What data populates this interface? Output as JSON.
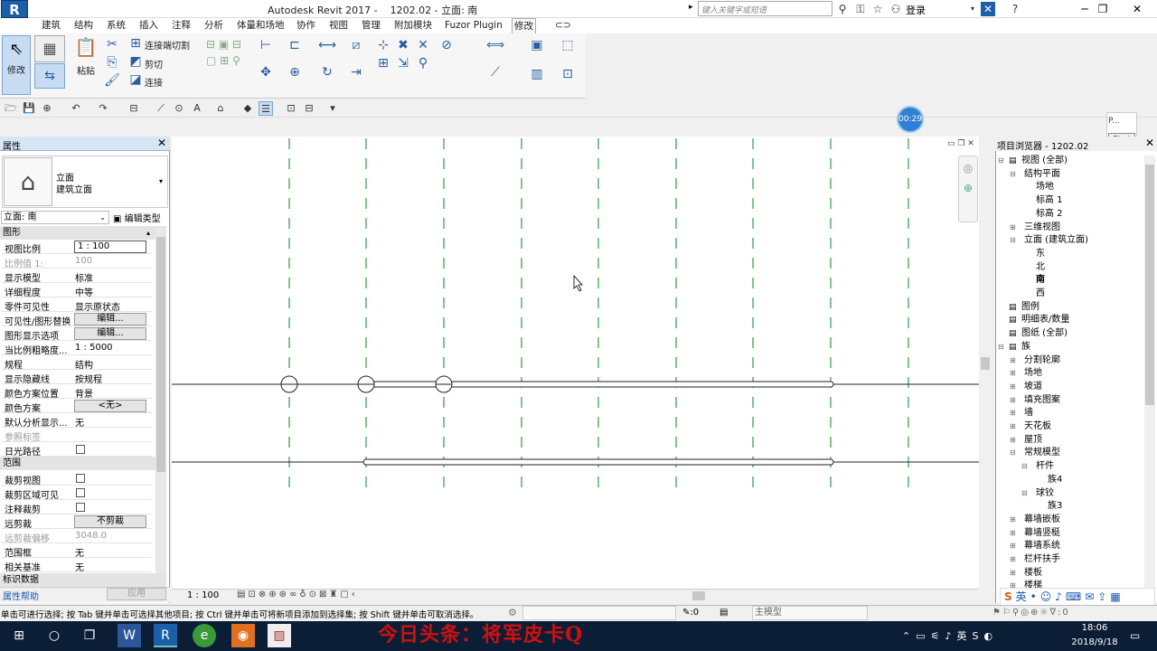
{
  "titlebar": {
    "app_logo": "R",
    "title": "Autodesk Revit 2017 -    1202.02 - 立面: 南",
    "search_placeholder": "键入关键字或短语",
    "login": "登录"
  },
  "tabs": [
    "建筑",
    "结构",
    "系统",
    "插入",
    "注释",
    "分析",
    "体量和场地",
    "协作",
    "视图",
    "管理",
    "附加模块",
    "Fuzor Plugin",
    "修改"
  ],
  "active_tab": "修改",
  "ribbon": {
    "modify_label": "修改",
    "paste_label": "粘贴",
    "join_cut_label": "连接端切割",
    "cut_label": "剪切",
    "join_label": "连接"
  },
  "timer": "00:29",
  "recorder": {
    "label": "P...",
    "start": "Start"
  },
  "properties": {
    "header": "属性",
    "type_line1": "立面",
    "type_line2": "建筑立面",
    "instance_selector": "立面: 南",
    "edit_type": "编辑类型",
    "group_graphics": "图形",
    "rows": [
      {
        "name": "视图比例",
        "value": "1 : 100"
      },
      {
        "name": "比例值 1:",
        "value": "100"
      },
      {
        "name": "显示模型",
        "value": "标准"
      },
      {
        "name": "详细程度",
        "value": "中等"
      },
      {
        "name": "零件可见性",
        "value": "显示原状态"
      },
      {
        "name": "可见性/图形替换",
        "value": "编辑..."
      },
      {
        "name": "图形显示选项",
        "value": "编辑..."
      },
      {
        "name": "当比例粗略度...",
        "value": "1 : 5000"
      },
      {
        "name": "规程",
        "value": "结构"
      },
      {
        "name": "显示隐藏线",
        "value": "按规程"
      },
      {
        "name": "颜色方案位置",
        "value": "背景"
      },
      {
        "name": "颜色方案",
        "value": "<无>"
      },
      {
        "name": "默认分析显示...",
        "value": "无"
      },
      {
        "name": "参照标签",
        "value": ""
      },
      {
        "name": "日光路径",
        "value": ""
      }
    ],
    "group_extents": "范围",
    "rows2": [
      {
        "name": "裁剪视图",
        "value": ""
      },
      {
        "name": "裁剪区域可见",
        "value": ""
      },
      {
        "name": "注释裁剪",
        "value": ""
      },
      {
        "name": "远剪裁",
        "value": "不剪裁"
      },
      {
        "name": "远剪裁偏移",
        "value": "3048.0"
      },
      {
        "name": "范围框",
        "value": "无"
      },
      {
        "name": "相关基准",
        "value": "无"
      }
    ],
    "group_identity": "标识数据",
    "help": "属性帮助",
    "apply": "应用"
  },
  "view_bar": {
    "scale": "1 : 100"
  },
  "browser": {
    "header": "项目浏览器 - 1202.02",
    "nodes": [
      {
        "label": "视图 (全部)",
        "level": 0,
        "bold": false
      },
      {
        "label": "结构平面",
        "level": 1
      },
      {
        "label": "场地",
        "level": 2
      },
      {
        "label": "标高 1",
        "level": 2
      },
      {
        "label": "标高 2",
        "level": 2
      },
      {
        "label": "三维视图",
        "level": 1
      },
      {
        "label": "立面 (建筑立面)",
        "level": 1
      },
      {
        "label": "东",
        "level": 2
      },
      {
        "label": "北",
        "level": 2
      },
      {
        "label": "南",
        "level": 2,
        "bold": true
      },
      {
        "label": "西",
        "level": 2
      },
      {
        "label": "图例",
        "level": 0
      },
      {
        "label": "明细表/数量",
        "level": 0
      },
      {
        "label": "图纸 (全部)",
        "level": 0
      },
      {
        "label": "族",
        "level": 0
      },
      {
        "label": "分割轮廓",
        "level": 1
      },
      {
        "label": "场地",
        "level": 1
      },
      {
        "label": "坡道",
        "level": 1
      },
      {
        "label": "填充图案",
        "level": 1
      },
      {
        "label": "墙",
        "level": 1
      },
      {
        "label": "天花板",
        "level": 1
      },
      {
        "label": "屋顶",
        "level": 1
      },
      {
        "label": "常规模型",
        "level": 1
      },
      {
        "label": "杆件",
        "level": 2
      },
      {
        "label": "族4",
        "level": 3
      },
      {
        "label": "球铰",
        "level": 2
      },
      {
        "label": "族3",
        "level": 3
      },
      {
        "label": "幕墙嵌板",
        "level": 1
      },
      {
        "label": "幕墙竖梃",
        "level": 1
      },
      {
        "label": "幕墙系统",
        "level": 1
      },
      {
        "label": "栏杆扶手",
        "level": 1
      },
      {
        "label": "楼板",
        "level": 1
      },
      {
        "label": "楼梯",
        "level": 1
      }
    ]
  },
  "status": {
    "message": "单击可进行选择; 按 Tab 键并单击可选择其他项目; 按 Ctrl 键并单击可将新项目添加到选择集; 按 Shift 键并单击可取消选择。",
    "count": ":0",
    "model": "主模型",
    "filter": ":0"
  },
  "taskbar": {
    "ime": "英",
    "time": "18:06",
    "date": "2018/9/18"
  },
  "watermark": "今日头条：将军皮卡Q",
  "colors": {
    "grid_line": "#2e9e3e",
    "accent": "#1b5fa8",
    "watermark": "#d01010"
  }
}
